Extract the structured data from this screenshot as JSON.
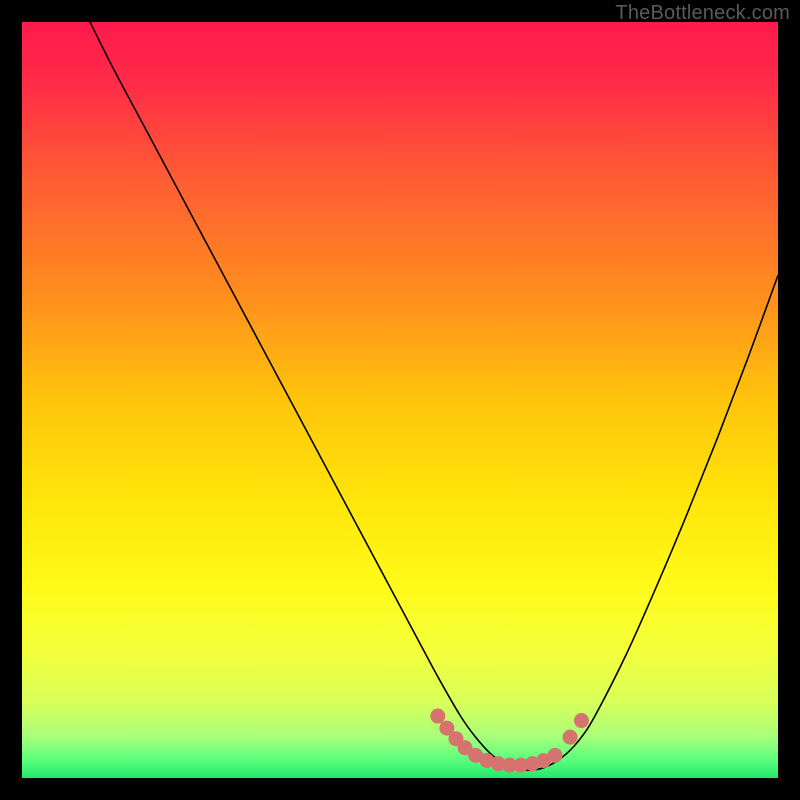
{
  "watermark": "TheBottleneck.com",
  "chart_data": {
    "type": "line",
    "title": "",
    "xlabel": "",
    "ylabel": "",
    "xlim": [
      0,
      100
    ],
    "ylim": [
      0,
      100
    ],
    "grid": false,
    "legend": false,
    "gradient_stops": [
      {
        "offset": 0.0,
        "color": "#ff1a4d"
      },
      {
        "offset": 0.08,
        "color": "#ff2b47"
      },
      {
        "offset": 0.2,
        "color": "#ff5a34"
      },
      {
        "offset": 0.35,
        "color": "#ff8a1f"
      },
      {
        "offset": 0.5,
        "color": "#ffc40c"
      },
      {
        "offset": 0.63,
        "color": "#ffe50a"
      },
      {
        "offset": 0.75,
        "color": "#fffb1a"
      },
      {
        "offset": 0.83,
        "color": "#f4ff3a"
      },
      {
        "offset": 0.9,
        "color": "#d8ff5a"
      },
      {
        "offset": 0.945,
        "color": "#a8ff7a"
      },
      {
        "offset": 0.975,
        "color": "#5dff7d"
      },
      {
        "offset": 1.0,
        "color": "#22e86b"
      }
    ],
    "series": [
      {
        "name": "bottleneck-curve",
        "color": "#000000",
        "stroke_width": 1.6,
        "x": [
          9,
          12,
          16,
          20,
          24,
          28,
          32,
          36,
          40,
          44,
          48,
          52,
          55,
          58,
          60,
          62,
          64,
          66,
          68,
          70,
          72,
          74,
          76,
          80,
          84,
          88,
          92,
          96,
          100
        ],
        "y": [
          100,
          94,
          86.5,
          79,
          71.5,
          64,
          56.5,
          49,
          41.5,
          34,
          26.5,
          19,
          13.4,
          8.2,
          5.4,
          3.2,
          1.8,
          1.1,
          1.1,
          1.8,
          3.2,
          5.4,
          8.6,
          16.5,
          25.5,
          35,
          45,
          55.5,
          66.5
        ]
      }
    ],
    "markers": {
      "name": "bottom-caps",
      "color": "#d6736f",
      "radius": 7.5,
      "points": [
        {
          "x": 55.0,
          "y": 8.2
        },
        {
          "x": 56.2,
          "y": 6.6
        },
        {
          "x": 57.4,
          "y": 5.2
        },
        {
          "x": 58.6,
          "y": 4.0
        },
        {
          "x": 60.0,
          "y": 3.0
        },
        {
          "x": 61.5,
          "y": 2.3
        },
        {
          "x": 63.0,
          "y": 1.9
        },
        {
          "x": 64.5,
          "y": 1.7
        },
        {
          "x": 66.0,
          "y": 1.7
        },
        {
          "x": 67.5,
          "y": 1.9
        },
        {
          "x": 69.0,
          "y": 2.3
        },
        {
          "x": 70.5,
          "y": 3.0
        },
        {
          "x": 72.5,
          "y": 5.4
        },
        {
          "x": 74.0,
          "y": 7.6
        }
      ]
    }
  }
}
